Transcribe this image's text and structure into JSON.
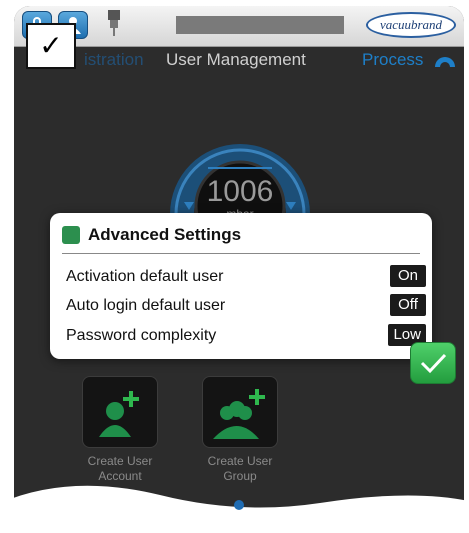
{
  "header": {
    "logo_text": "vacuubrand"
  },
  "tabs": {
    "administration": "istration",
    "user_management": "User Management",
    "process": "Process"
  },
  "gauge": {
    "value": "1006",
    "unit": "mbar"
  },
  "dialog": {
    "title": "Advanced Settings",
    "rows": [
      {
        "label": "Activation default user",
        "value": "On"
      },
      {
        "label": "Auto login default user",
        "value": "Off"
      },
      {
        "label": "Password complexity",
        "value": "Low"
      }
    ]
  },
  "actions": {
    "create_account": [
      "Create User",
      "Account"
    ],
    "create_group": [
      "Create User",
      "Group"
    ]
  },
  "overlay_check": "✓",
  "colors": {
    "accent_blue": "#1e7fc8",
    "confirm_green": "#2fb84e",
    "value_box": "#1b1b1b"
  }
}
